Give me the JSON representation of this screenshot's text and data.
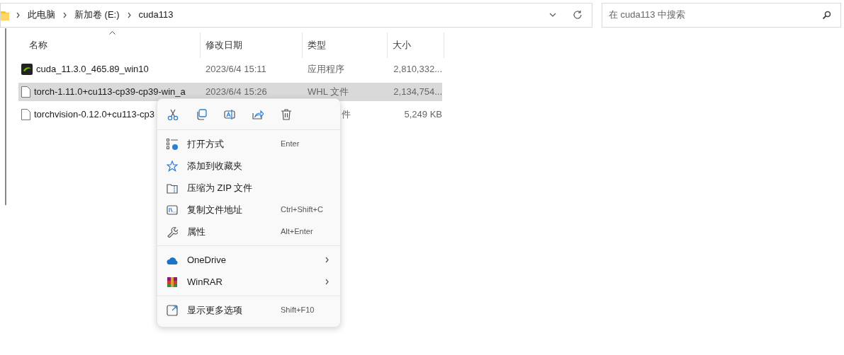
{
  "address_bar": {
    "breadcrumbs": [
      "此电脑",
      "新加卷 (E:)",
      "cuda113"
    ]
  },
  "search": {
    "placeholder": "在 cuda113 中搜索"
  },
  "columns": [
    {
      "label": "名称",
      "sorted": true
    },
    {
      "label": "修改日期",
      "sorted": false
    },
    {
      "label": "类型",
      "sorted": false
    },
    {
      "label": "大小",
      "sorted": false
    }
  ],
  "files": [
    {
      "name": "cuda_11.3.0_465.89_win10",
      "kind": "app",
      "modified": "2023/6/4 15:11",
      "type": "应用程序",
      "size": "2,810,332...",
      "selected": false
    },
    {
      "name": "torch-1.11.0+cu113-cp39-cp39-win_a",
      "kind": "file",
      "modified": "2023/6/4 15:26",
      "type": "WHL 文件",
      "size": "2,134,754...",
      "selected": true
    },
    {
      "name": "torchvision-0.12.0+cu113-cp3",
      "kind": "file",
      "type": "件",
      "size": "5,249 KB",
      "selected": false
    }
  ],
  "context_menu": {
    "quick_actions": [
      {
        "kind": "cut"
      },
      {
        "kind": "copy"
      },
      {
        "kind": "rename"
      },
      {
        "kind": "share"
      },
      {
        "kind": "delete"
      }
    ],
    "groups": [
      [
        {
          "kind": "open_with",
          "label": "打开方式",
          "shortcut": "Enter",
          "submenu": false
        },
        {
          "kind": "favorite",
          "label": "添加到收藏夹",
          "submenu": false
        },
        {
          "kind": "zip",
          "label": "压缩为 ZIP 文件",
          "submenu": false
        },
        {
          "kind": "copy_path",
          "label": "复制文件地址",
          "shortcut": "Ctrl+Shift+C",
          "submenu": false
        },
        {
          "kind": "properties",
          "label": "属性",
          "shortcut": "Alt+Enter",
          "submenu": false
        }
      ],
      [
        {
          "kind": "cloud",
          "label": "OneDrive",
          "submenu": true
        },
        {
          "kind": "winrar",
          "label": "WinRAR",
          "submenu": true
        }
      ],
      [
        {
          "kind": "more",
          "label": "显示更多选项",
          "shortcut": "Shift+F10",
          "submenu": false
        }
      ]
    ]
  }
}
